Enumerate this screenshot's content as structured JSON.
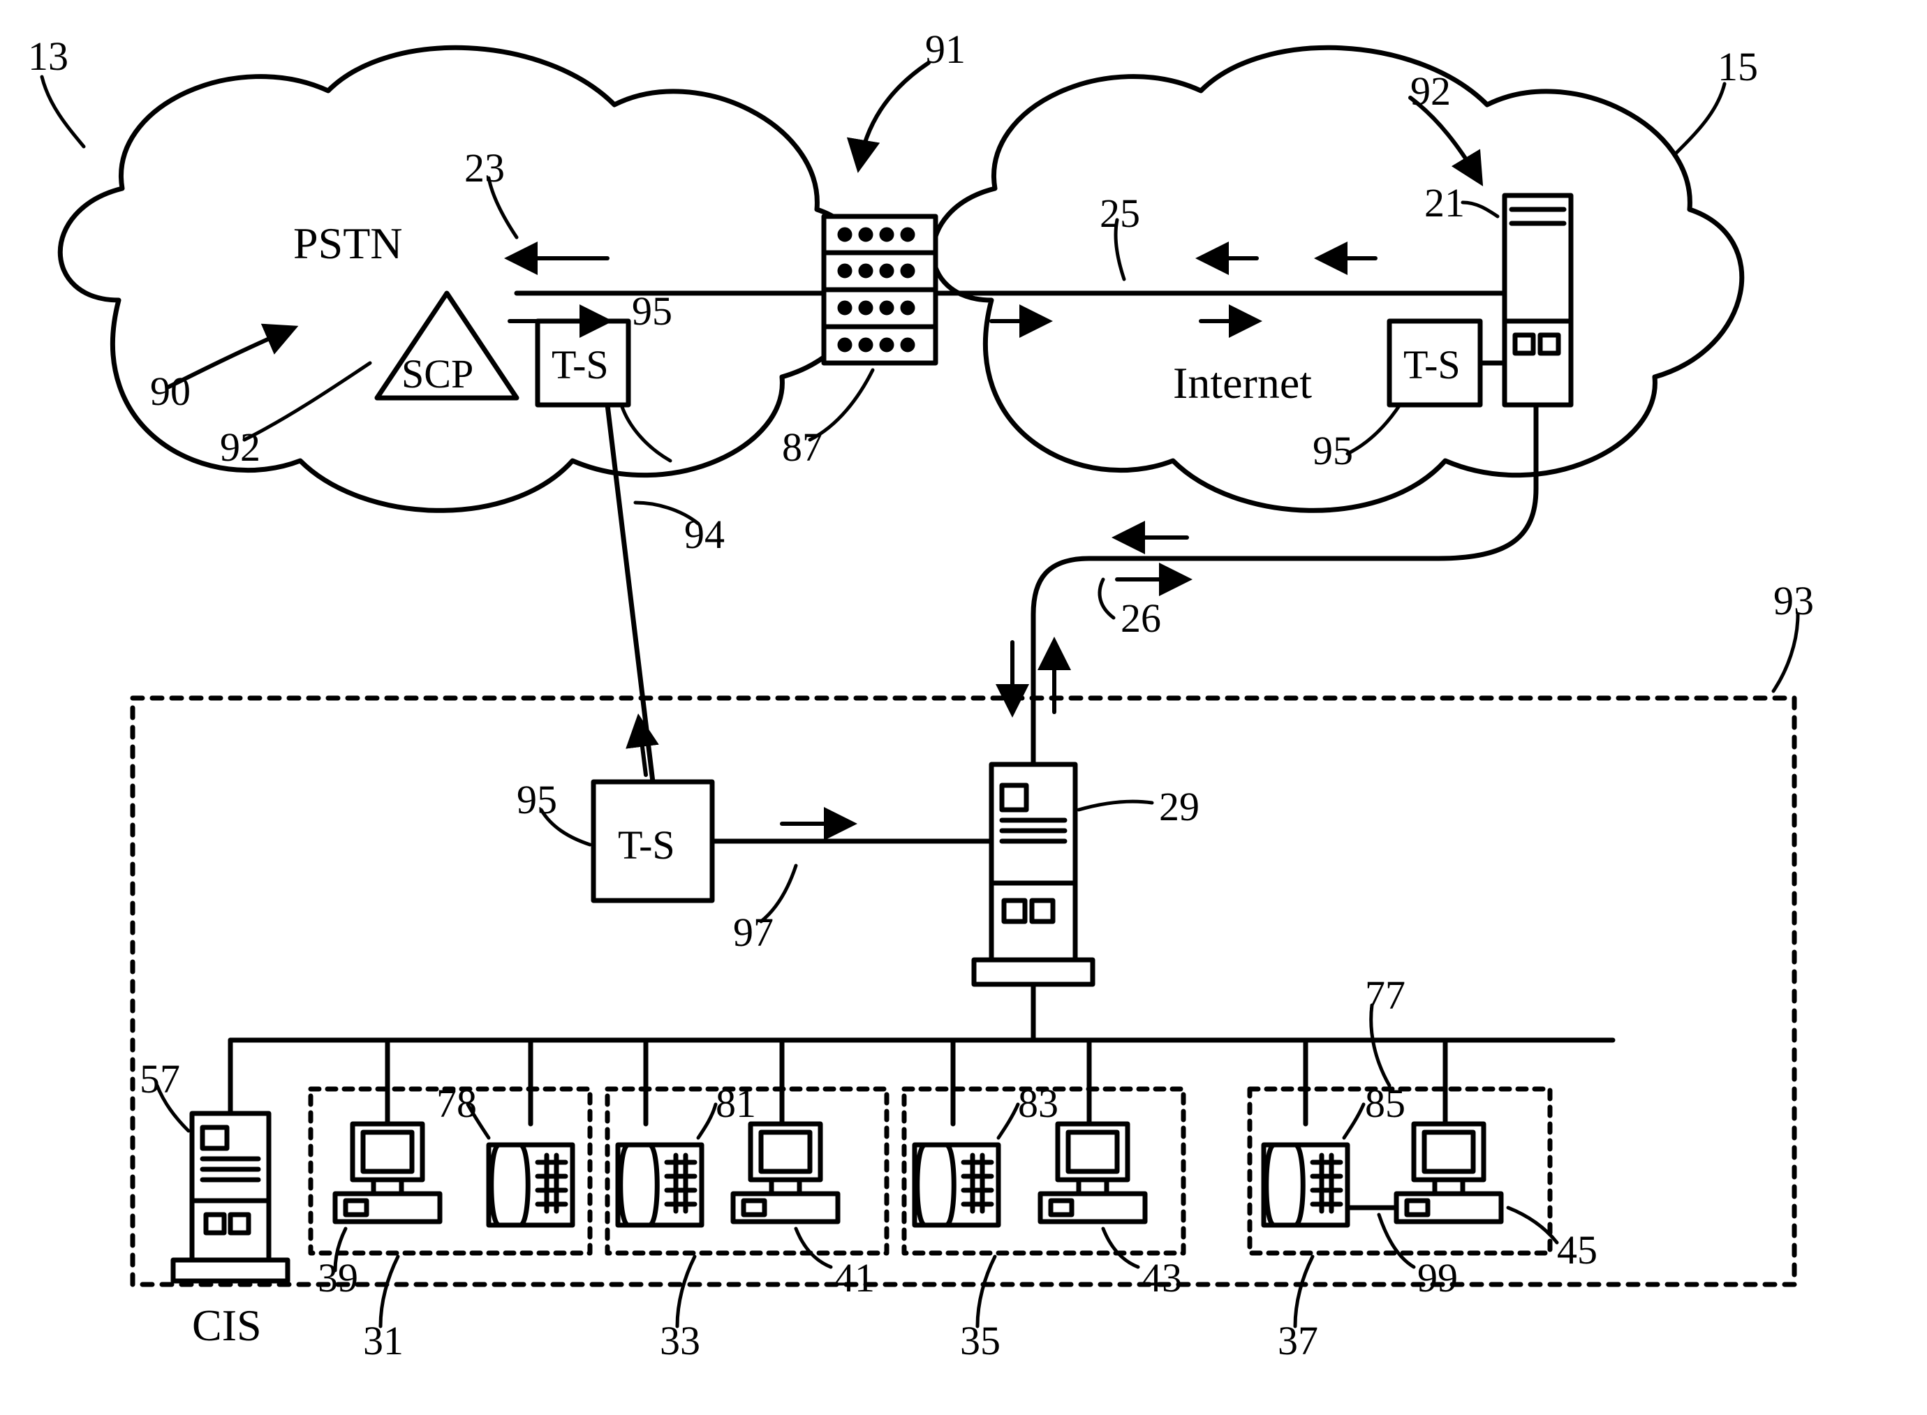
{
  "labels": {
    "n13": "13",
    "n15": "15",
    "n91": "91",
    "n92a": "92",
    "n92b": "92",
    "n90": "90",
    "n23": "23",
    "n25": "25",
    "n21": "21",
    "n95a": "95",
    "n95b": "95",
    "n95c": "95",
    "n87": "87",
    "n94": "94",
    "n26": "26",
    "n93": "93",
    "n29": "29",
    "n97": "97",
    "n77": "77",
    "n57": "57",
    "n78": "78",
    "n81": "81",
    "n83": "83",
    "n85": "85",
    "n39": "39",
    "n41": "41",
    "n43": "43",
    "n45": "45",
    "n99": "99",
    "n31": "31",
    "n33": "33",
    "n35": "35",
    "n37": "37",
    "pstn": "PSTN",
    "internet": "Internet",
    "scp": "SCP",
    "ts": "T-S",
    "cis": "CIS"
  }
}
